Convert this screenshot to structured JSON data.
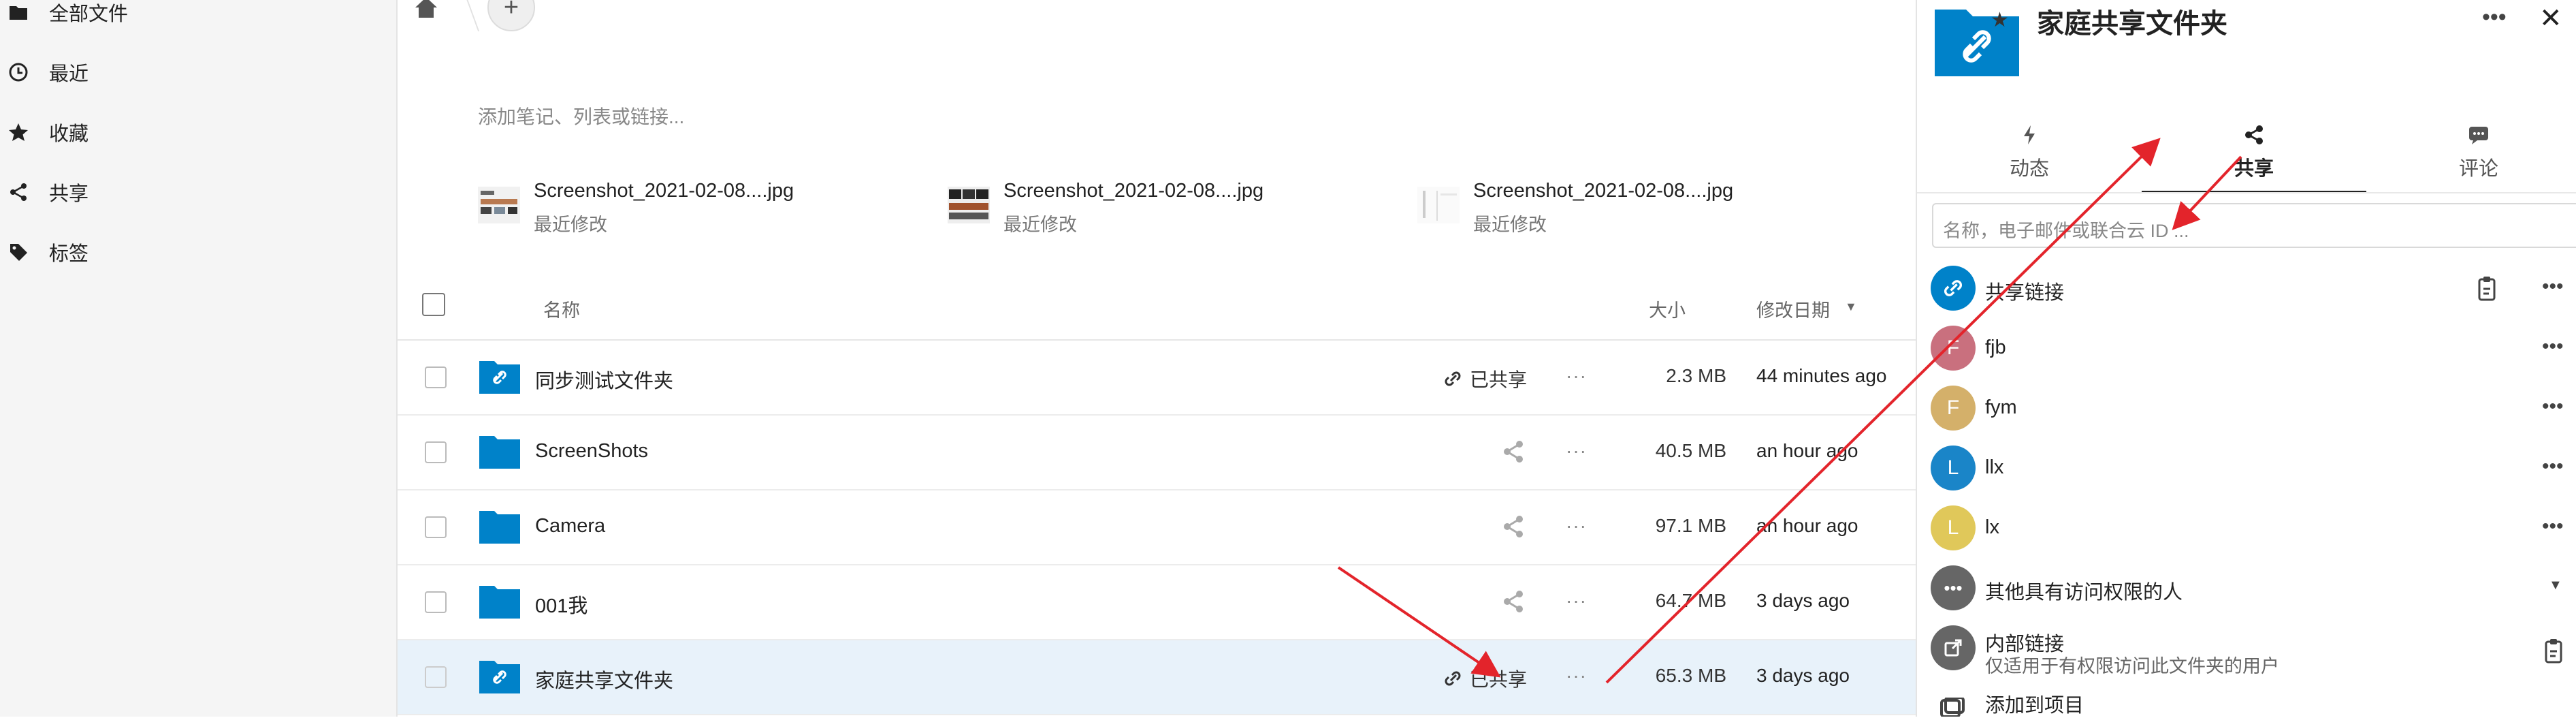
{
  "sidebar": {
    "items": [
      {
        "label": "全部文件",
        "icon": "folder-icon"
      },
      {
        "label": "最近",
        "icon": "clock-icon"
      },
      {
        "label": "收藏",
        "icon": "star-icon"
      },
      {
        "label": "共享",
        "icon": "share-icon"
      },
      {
        "label": "标签",
        "icon": "tag-icon"
      }
    ]
  },
  "toolbar": {
    "add_label": "+"
  },
  "notes": {
    "placeholder": "添加笔记、列表或链接..."
  },
  "recent_files": [
    {
      "name": "Screenshot_2021-02-08....jpg",
      "sub": "最近修改"
    },
    {
      "name": "Screenshot_2021-02-08....jpg",
      "sub": "最近修改"
    },
    {
      "name": "Screenshot_2021-02-08....jpg",
      "sub": "最近修改"
    }
  ],
  "table": {
    "headers": {
      "name": "名称",
      "size": "大小",
      "modified": "修改日期"
    },
    "rows": [
      {
        "name": "同步测试文件夹",
        "shared_label": "已共享",
        "size": "2.3 MB",
        "date": "44 minutes ago",
        "more": "···"
      },
      {
        "name": "ScreenShots",
        "shared_label": "",
        "size": "40.5 MB",
        "date": "an hour ago",
        "more": "···"
      },
      {
        "name": "Camera",
        "shared_label": "",
        "size": "97.1 MB",
        "date": "an hour ago",
        "more": "···"
      },
      {
        "name": "001我",
        "shared_label": "",
        "size": "64.7 MB",
        "date": "3 days ago",
        "more": "···"
      },
      {
        "name": "家庭共享文件夹",
        "shared_label": "已共享",
        "size": "65.3 MB",
        "date": "3 days ago",
        "more": "···"
      }
    ]
  },
  "panel": {
    "title": "家庭共享文件夹",
    "dots": "•••",
    "close": "✕",
    "tabs": [
      {
        "label": "动态",
        "icon": "activity-icon"
      },
      {
        "label": "共享",
        "icon": "share-icon"
      },
      {
        "label": "评论",
        "icon": "comment-icon"
      }
    ],
    "share_input_placeholder": "名称，电子邮件或联合云 ID ...",
    "share_link_label": "共享链接",
    "shares": [
      {
        "initial": "F",
        "name": "fjb",
        "color": "#c9707e"
      },
      {
        "initial": "F",
        "name": "fym",
        "color": "#d4b06a"
      },
      {
        "initial": "L",
        "name": "llx",
        "color": "#1a85c8"
      },
      {
        "initial": "L",
        "name": "lx",
        "color": "#e0c85a"
      }
    ],
    "others_label": "其他具有访问权限的人",
    "internal_link_label": "内部链接",
    "internal_link_sub": "仅适用于有权限访问此文件夹的用户",
    "add_project_label": "添加到项目"
  },
  "colors": {
    "accent": "#0082c9",
    "arrow": "#e3242b",
    "selected_row": "#e8f2fa"
  }
}
